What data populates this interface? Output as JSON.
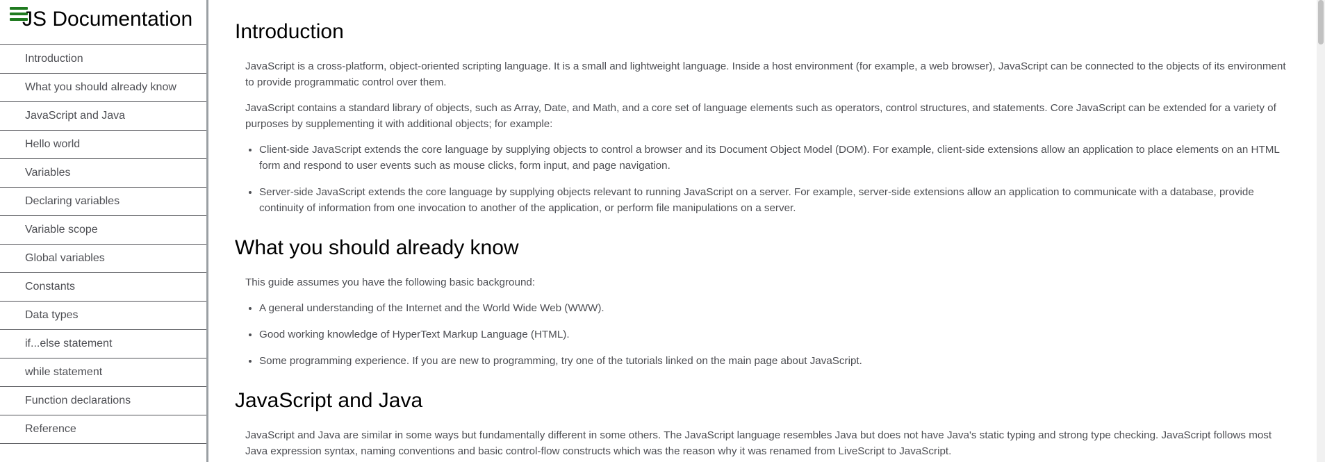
{
  "nav": {
    "title": "JS Documentation",
    "items": [
      {
        "label": "Introduction"
      },
      {
        "label": "What you should already know"
      },
      {
        "label": "JavaScript and Java"
      },
      {
        "label": "Hello world"
      },
      {
        "label": "Variables"
      },
      {
        "label": "Declaring variables"
      },
      {
        "label": "Variable scope"
      },
      {
        "label": "Global variables"
      },
      {
        "label": "Constants"
      },
      {
        "label": "Data types"
      },
      {
        "label": "if...else statement"
      },
      {
        "label": "while statement"
      },
      {
        "label": "Function declarations"
      },
      {
        "label": "Reference"
      }
    ]
  },
  "sections": {
    "introduction": {
      "title": "Introduction",
      "p1": "JavaScript is a cross-platform, object-oriented scripting language. It is a small and lightweight language. Inside a host environment (for example, a web browser), JavaScript can be connected to the objects of its environment to provide programmatic control over them.",
      "p2": "JavaScript contains a standard library of objects, such as Array, Date, and Math, and a core set of language elements such as operators, control structures, and statements. Core JavaScript can be extended for a variety of purposes by supplementing it with additional objects; for example:",
      "items": [
        "Client-side JavaScript extends the core language by supplying objects to control a browser and its Document Object Model (DOM). For example, client-side extensions allow an application to place elements on an HTML form and respond to user events such as mouse clicks, form input, and page navigation.",
        "Server-side JavaScript extends the core language by supplying objects relevant to running JavaScript on a server. For example, server-side extensions allow an application to communicate with a database, provide continuity of information from one invocation to another of the application, or perform file manipulations on a server."
      ]
    },
    "already_know": {
      "title": "What you should already know",
      "p1": "This guide assumes you have the following basic background:",
      "items": [
        "A general understanding of the Internet and the World Wide Web (WWW).",
        "Good working knowledge of HyperText Markup Language (HTML).",
        "Some programming experience. If you are new to programming, try one of the tutorials linked on the main page about JavaScript."
      ]
    },
    "js_java": {
      "title": "JavaScript and Java",
      "p1": "JavaScript and Java are similar in some ways but fundamentally different in some others. The JavaScript language resembles Java but does not have Java's static typing and strong type checking. JavaScript follows most Java expression syntax, naming conventions and basic control-flow constructs which was the reason why it was renamed from LiveScript to JavaScript."
    }
  },
  "icons": {
    "menu": "hamburger-menu-icon"
  },
  "colors": {
    "menu_icon": "#1f7a1f",
    "text": "#4d4e53",
    "heading": "#000000",
    "nav_border": "#9a9fa3"
  }
}
